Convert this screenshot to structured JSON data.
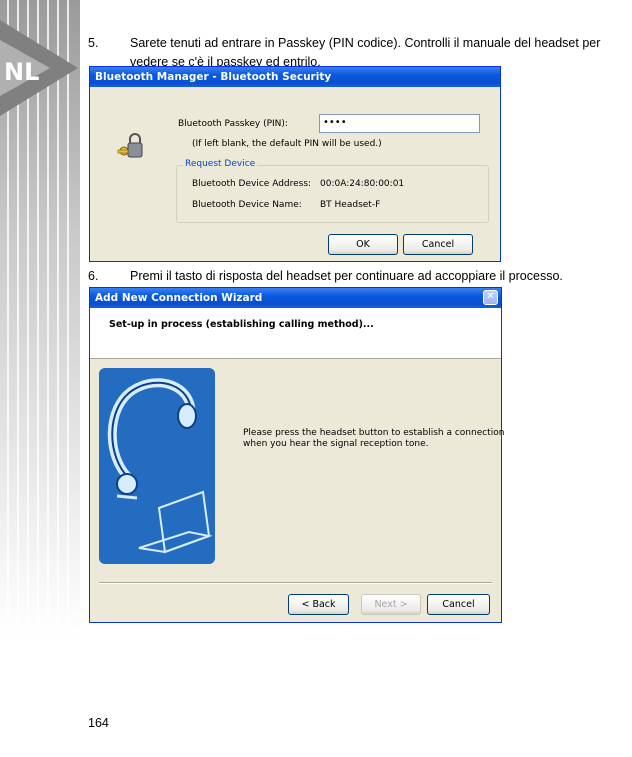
{
  "step5": {
    "number": "5.",
    "text": "Sarete tenuti ad entrare in Passkey (PIN codice). Controlli il manuale del headset per vedere se c'è il passkey ed entrilo."
  },
  "dialog_security": {
    "title": "Bluetooth Manager - Bluetooth Security",
    "passkey_label": "Bluetooth Passkey (PIN):",
    "passkey_value": "••••",
    "hint": "(If left blank, the default PIN will be used.)",
    "group_title": "Request Device",
    "address_label": "Bluetooth Device Address:",
    "address_value": "00:0A:24:80:00:01",
    "name_label": "Bluetooth Device Name:",
    "name_value": "BT Headset-F",
    "ok_label": "OK",
    "cancel_label": "Cancel"
  },
  "step6": {
    "number": "6.",
    "text": "Premi il tasto di risposta del headset per continuare ad accoppiare il processo."
  },
  "dialog_wizard": {
    "title": "Add New Connection Wizard",
    "close_symbol": "✕",
    "heading": "Set-up in process (establishing calling method)...",
    "message_line1": "Please press the headset button to establish a connection",
    "message_line2": "when you hear the signal reception tone.",
    "back_label": "< Back",
    "next_label": "Next >",
    "cancel_label": "Cancel"
  },
  "page_number": "164",
  "colors": {
    "titlebar": "#0a58e0",
    "dialog_bg": "#ece9d8",
    "illustration_blue": "#1a5fb4"
  }
}
